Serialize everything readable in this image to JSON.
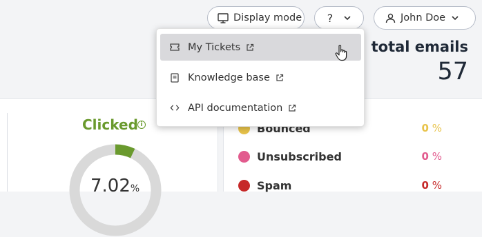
{
  "header": {
    "display_mode_label": "Display mode",
    "help_label": "?",
    "user_name": "John Doe"
  },
  "stats": {
    "total_label": "total emails",
    "total_value": "57"
  },
  "help_menu": {
    "items": [
      {
        "label": "My Tickets",
        "icon": "ticket-icon",
        "external": true
      },
      {
        "label": "Knowledge base",
        "icon": "book-icon",
        "external": true
      },
      {
        "label": "API documentation",
        "icon": "code-icon",
        "external": true
      }
    ]
  },
  "clicked": {
    "title": "Clicked",
    "value": "7.02",
    "unit": "%",
    "fraction": 0.0702,
    "color": "#6a9a2e",
    "track_color": "#d9d9d9"
  },
  "legend": [
    {
      "label": "Bounced",
      "value": "0",
      "unit": "%",
      "color": "#e8c34a"
    },
    {
      "label": "Unsubscribed",
      "value": "0",
      "unit": "%",
      "color": "#e25b8e"
    },
    {
      "label": "Spam",
      "value": "0",
      "unit": "%",
      "color": "#c62828"
    }
  ]
}
